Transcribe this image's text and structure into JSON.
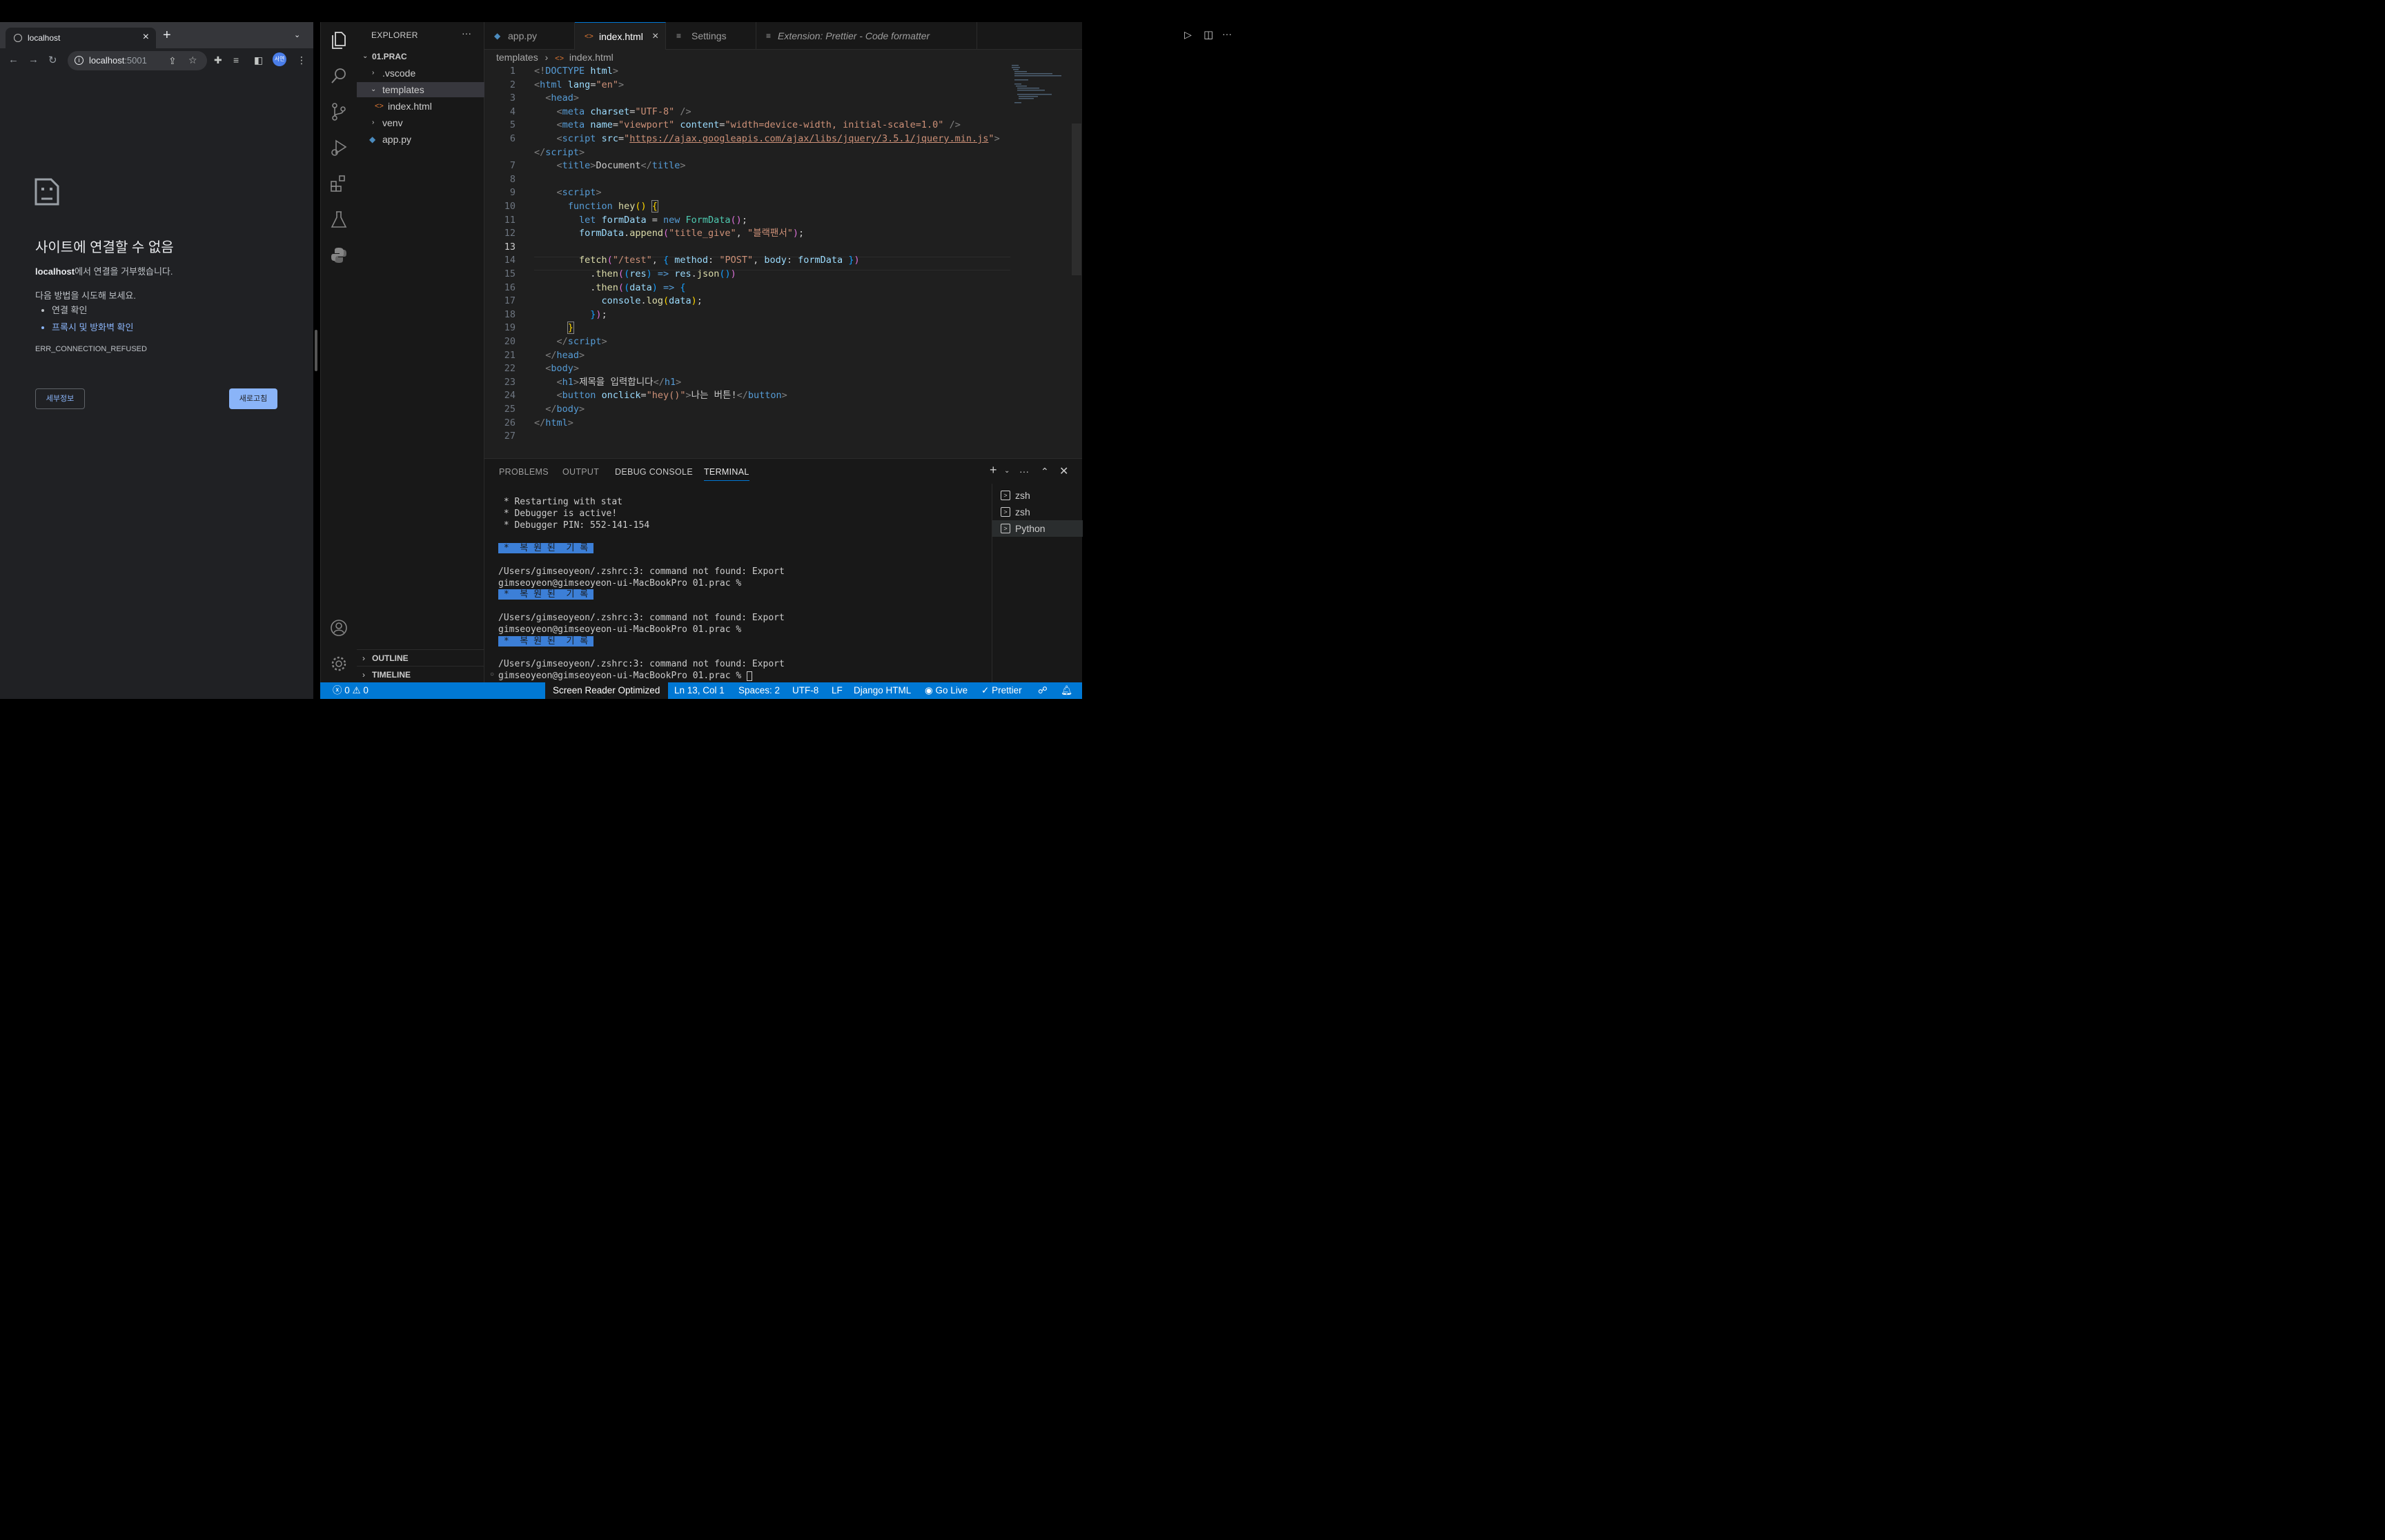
{
  "browser": {
    "tab_title": "localhost",
    "url_host": "localhost",
    "url_port": ":5001",
    "profile_initials": "서연",
    "error": {
      "title": "사이트에 연결할 수 없음",
      "host": "localhost",
      "message": "에서 연결을 거부했습니다.",
      "try_text": "다음 방법을 시도해 보세요.",
      "suggestions": [
        "연결 확인",
        "프록시 및 방화벽 확인"
      ],
      "code": "ERR_CONNECTION_REFUSED",
      "details_button": "세부정보",
      "reload_button": "새로고침"
    }
  },
  "explorer": {
    "header": "EXPLORER",
    "root": "01.PRAC",
    "items": [
      ".vscode",
      "templates",
      "index.html",
      "venv",
      "app.py"
    ],
    "outline": "OUTLINE",
    "timeline": "TIMELINE"
  },
  "editor": {
    "tabs": [
      "app.py",
      "index.html",
      "Settings",
      "Extension: Prettier - Code formatter"
    ],
    "breadcrumb": [
      "templates",
      "index.html"
    ],
    "line_numbers": [
      "1",
      "2",
      "3",
      "4",
      "5",
      "6",
      "",
      "7",
      "8",
      "9",
      "10",
      "11",
      "12",
      "13",
      "14",
      "15",
      "16",
      "17",
      "18",
      "19",
      "20",
      "21",
      "22",
      "23",
      "24",
      "25",
      "26",
      "27"
    ]
  },
  "panel": {
    "tabs": [
      "PROBLEMS",
      "OUTPUT",
      "DEBUG CONSOLE",
      "TERMINAL"
    ],
    "terminal_lines": [
      " * Restarting with stat",
      " * Debugger is active!",
      " * Debugger PIN: 552-141-154",
      "",
      " *  복 원 된  기 록 ",
      "",
      "/Users/gimseoyeon/.zshrc:3: command not found: Export",
      "gimseoyeon@gimseoyeon-ui-MacBookPro 01.prac %",
      " *  복 원 된  기 록 ",
      "",
      "/Users/gimseoyeon/.zshrc:3: command not found: Export",
      "gimseoyeon@gimseoyeon-ui-MacBookPro 01.prac %",
      " *  복 원 된  기 록 ",
      "",
      "/Users/gimseoyeon/.zshrc:3: command not found: Export",
      "gimseoyeon@gimseoyeon-ui-MacBookPro 01.prac % "
    ],
    "terminals": [
      "zsh",
      "zsh",
      "Python"
    ]
  },
  "status": {
    "errors": "0",
    "warnings": "0",
    "screen_reader": "Screen Reader Optimized",
    "position": "Ln 13, Col 1",
    "spaces": "Spaces: 2",
    "encoding": "UTF-8",
    "eol": "LF",
    "language": "Django HTML",
    "golive": "Go Live",
    "prettier": "Prettier"
  },
  "colors": {
    "accent": "#0078d4",
    "link": "#8ab4f8",
    "history": "#3c7fd7"
  }
}
